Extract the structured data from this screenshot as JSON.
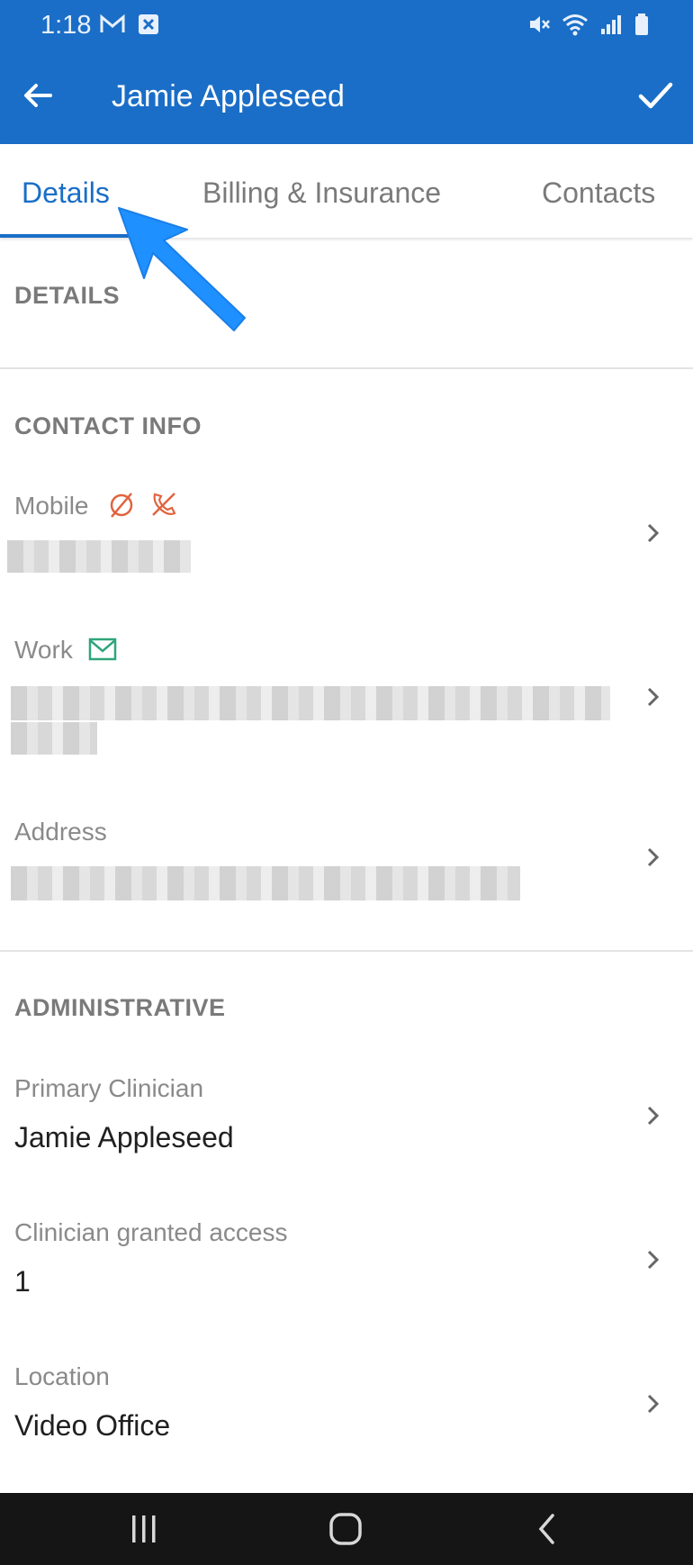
{
  "status_bar": {
    "time": "1:18",
    "icons": [
      "gmail-icon",
      "app-notification-icon",
      "mute-icon",
      "wifi-icon",
      "signal-icon",
      "battery-icon"
    ]
  },
  "app_bar": {
    "title": "Jamie Appleseed",
    "back_icon": "back-arrow-icon",
    "confirm_icon": "check-icon",
    "color": "#1a6ec7"
  },
  "tabs": [
    {
      "label": "Details",
      "active": true
    },
    {
      "label": "Billing & Insurance",
      "active": false
    },
    {
      "label": "Contacts",
      "active": false
    }
  ],
  "sections": {
    "details": {
      "header": "DETAILS"
    },
    "contact_info": {
      "header": "CONTACT INFO",
      "mobile": {
        "label": "Mobile",
        "icons": [
          "no-sms-icon",
          "no-call-icon"
        ]
      },
      "work": {
        "label": "Work",
        "icons": [
          "email-icon"
        ]
      },
      "address": {
        "label": "Address"
      }
    },
    "administrative": {
      "header": "ADMINISTRATIVE",
      "primary_clinician": {
        "label": "Primary Clinician",
        "value": "Jamie Appleseed"
      },
      "clinician_access": {
        "label": "Clinician granted access",
        "value": "1"
      },
      "location": {
        "label": "Location",
        "value": "Video Office"
      }
    }
  },
  "nav_bar": {
    "icons": [
      "recents-icon",
      "home-icon",
      "back-icon"
    ]
  }
}
